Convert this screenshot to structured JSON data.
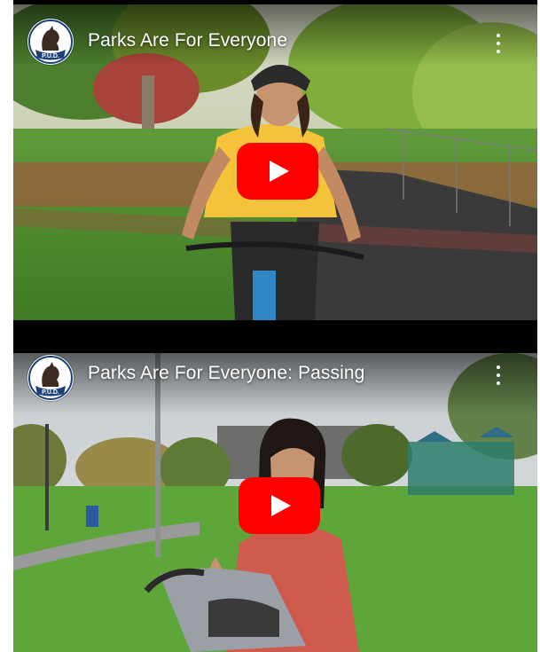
{
  "videos": [
    {
      "title": "Parks Are For Everyone",
      "channel_logo_text": "P.U.D.",
      "icons": {
        "menu": "more-vert-icon",
        "play": "youtube-play-icon",
        "logo": "channel-logo-icon"
      },
      "colors": {
        "play_red": "#ff0000",
        "shirt": "#f5c33a"
      }
    },
    {
      "title": "Parks Are For Everyone: Passing",
      "channel_logo_text": "P.U.D.",
      "icons": {
        "menu": "more-vert-icon",
        "play": "youtube-play-icon",
        "logo": "channel-logo-icon"
      },
      "colors": {
        "play_red": "#ff0000",
        "sweater": "#cf5a4e"
      }
    }
  ]
}
